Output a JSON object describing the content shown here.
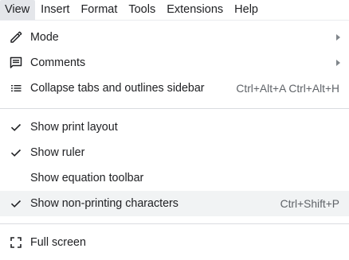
{
  "menubar": {
    "items": [
      {
        "label": "View"
      },
      {
        "label": "Insert"
      },
      {
        "label": "Format"
      },
      {
        "label": "Tools"
      },
      {
        "label": "Extensions"
      },
      {
        "label": "Help"
      }
    ],
    "active_index": 0
  },
  "view_menu": {
    "mode": {
      "label": "Mode",
      "icon": "pencil-icon"
    },
    "comments": {
      "label": "Comments",
      "icon": "comment-icon"
    },
    "collapse_sidebar": {
      "label": "Collapse tabs and outlines sidebar",
      "shortcut": "Ctrl+Alt+A Ctrl+Alt+H",
      "icon": "list-icon"
    },
    "show_print_layout": {
      "label": "Show print layout",
      "checked": true
    },
    "show_ruler": {
      "label": "Show ruler",
      "checked": true
    },
    "show_equation_toolbar": {
      "label": "Show equation toolbar",
      "checked": false
    },
    "show_non_printing": {
      "label": "Show non-printing characters",
      "shortcut": "Ctrl+Shift+P",
      "checked": true
    },
    "full_screen": {
      "label": "Full screen",
      "icon": "fullscreen-icon"
    }
  },
  "colors": {
    "highlight": "#f1f3f4",
    "text": "#202124",
    "shortcut": "#5f6368",
    "separator": "#dadce0"
  }
}
